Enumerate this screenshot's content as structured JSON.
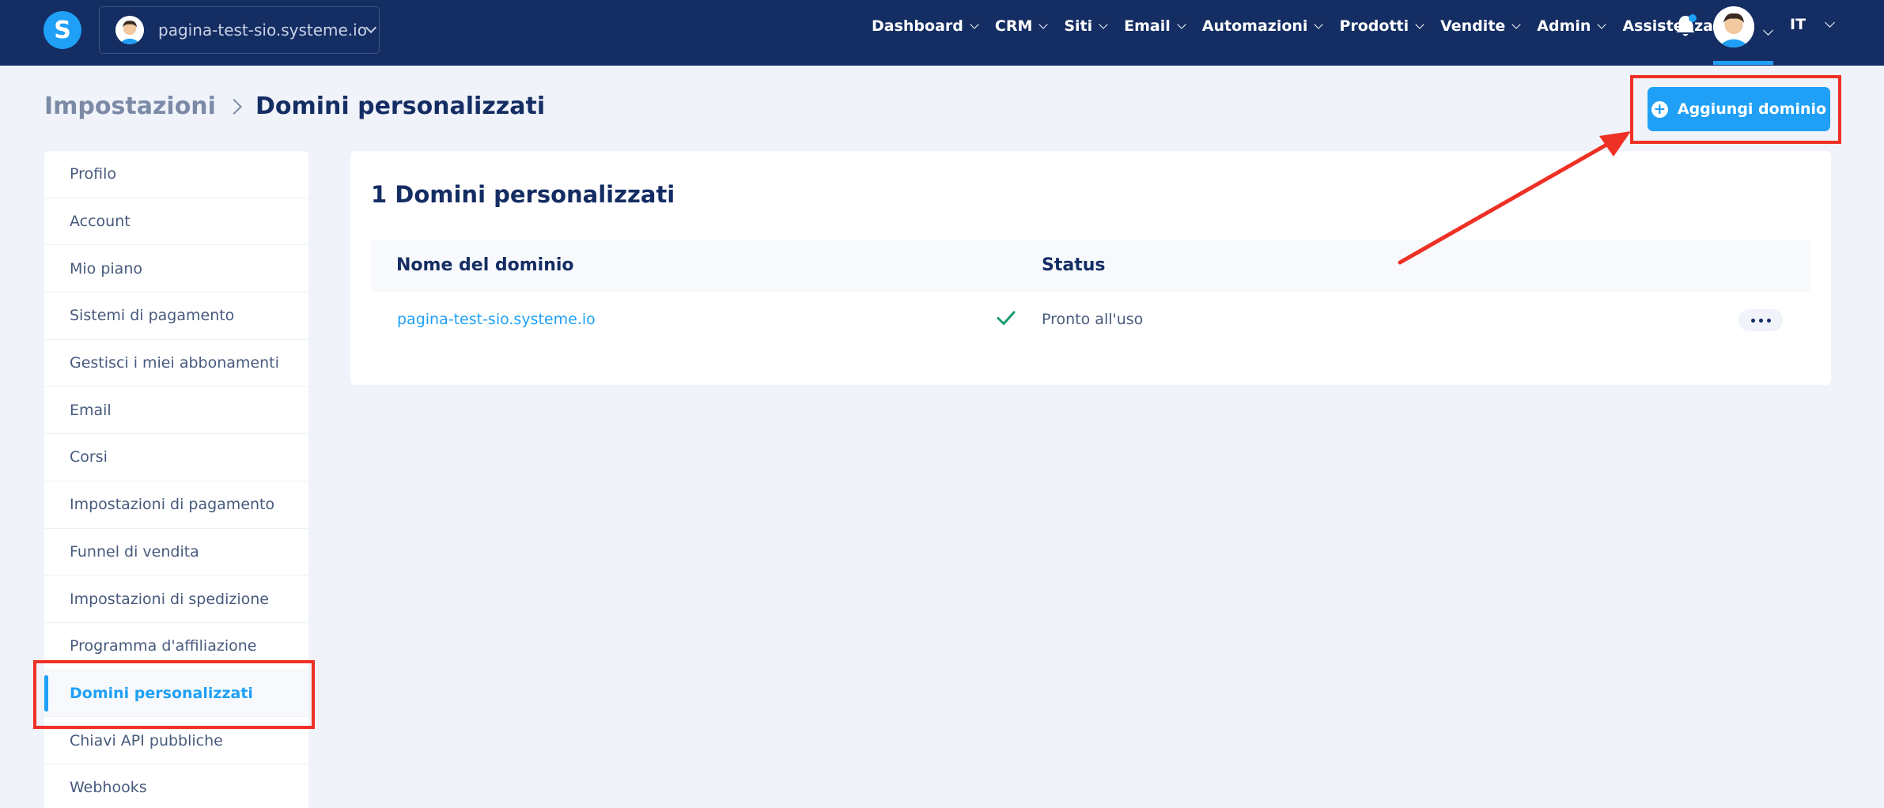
{
  "header": {
    "logo_letter": "S",
    "site_name": "pagina-test-sio.systeme.io",
    "nav": [
      {
        "label": "Dashboard"
      },
      {
        "label": "CRM"
      },
      {
        "label": "Siti"
      },
      {
        "label": "Email"
      },
      {
        "label": "Automazioni"
      },
      {
        "label": "Prodotti"
      },
      {
        "label": "Vendite"
      },
      {
        "label": "Admin"
      },
      {
        "label": "Assistenza"
      }
    ],
    "language": "IT"
  },
  "breadcrumb": {
    "parent": "Impostazioni",
    "current": "Domini personalizzati"
  },
  "actions": {
    "add_domain_label": "Aggiungi dominio"
  },
  "sidebar": {
    "items": [
      {
        "label": "Profilo"
      },
      {
        "label": "Account"
      },
      {
        "label": "Mio piano"
      },
      {
        "label": "Sistemi di pagamento"
      },
      {
        "label": "Gestisci i miei abbonamenti"
      },
      {
        "label": "Email"
      },
      {
        "label": "Corsi"
      },
      {
        "label": "Impostazioni di pagamento"
      },
      {
        "label": "Funnel di vendita"
      },
      {
        "label": "Impostazioni di spedizione"
      },
      {
        "label": "Programma d'affiliazione"
      },
      {
        "label": "Domini personalizzati"
      },
      {
        "label": "Chiavi API pubbliche"
      },
      {
        "label": "Webhooks"
      }
    ],
    "active_index": 11
  },
  "domains": {
    "title": "1 Domini personalizzati",
    "columns": {
      "domain": "Nome del dominio",
      "status": "Status"
    },
    "rows": [
      {
        "domain": "pagina-test-sio.systeme.io",
        "status": "Pronto all'uso"
      }
    ]
  },
  "colors": {
    "topbar": "#142d63",
    "accent": "#1fa0f6",
    "background": "#f0f3f9",
    "success": "#1a9b6c",
    "annotation": "#ee3124"
  },
  "icons": {
    "bell": "bell-icon",
    "check": "check-icon",
    "plus": "plus-circle-icon",
    "more": "more-dots-icon"
  }
}
